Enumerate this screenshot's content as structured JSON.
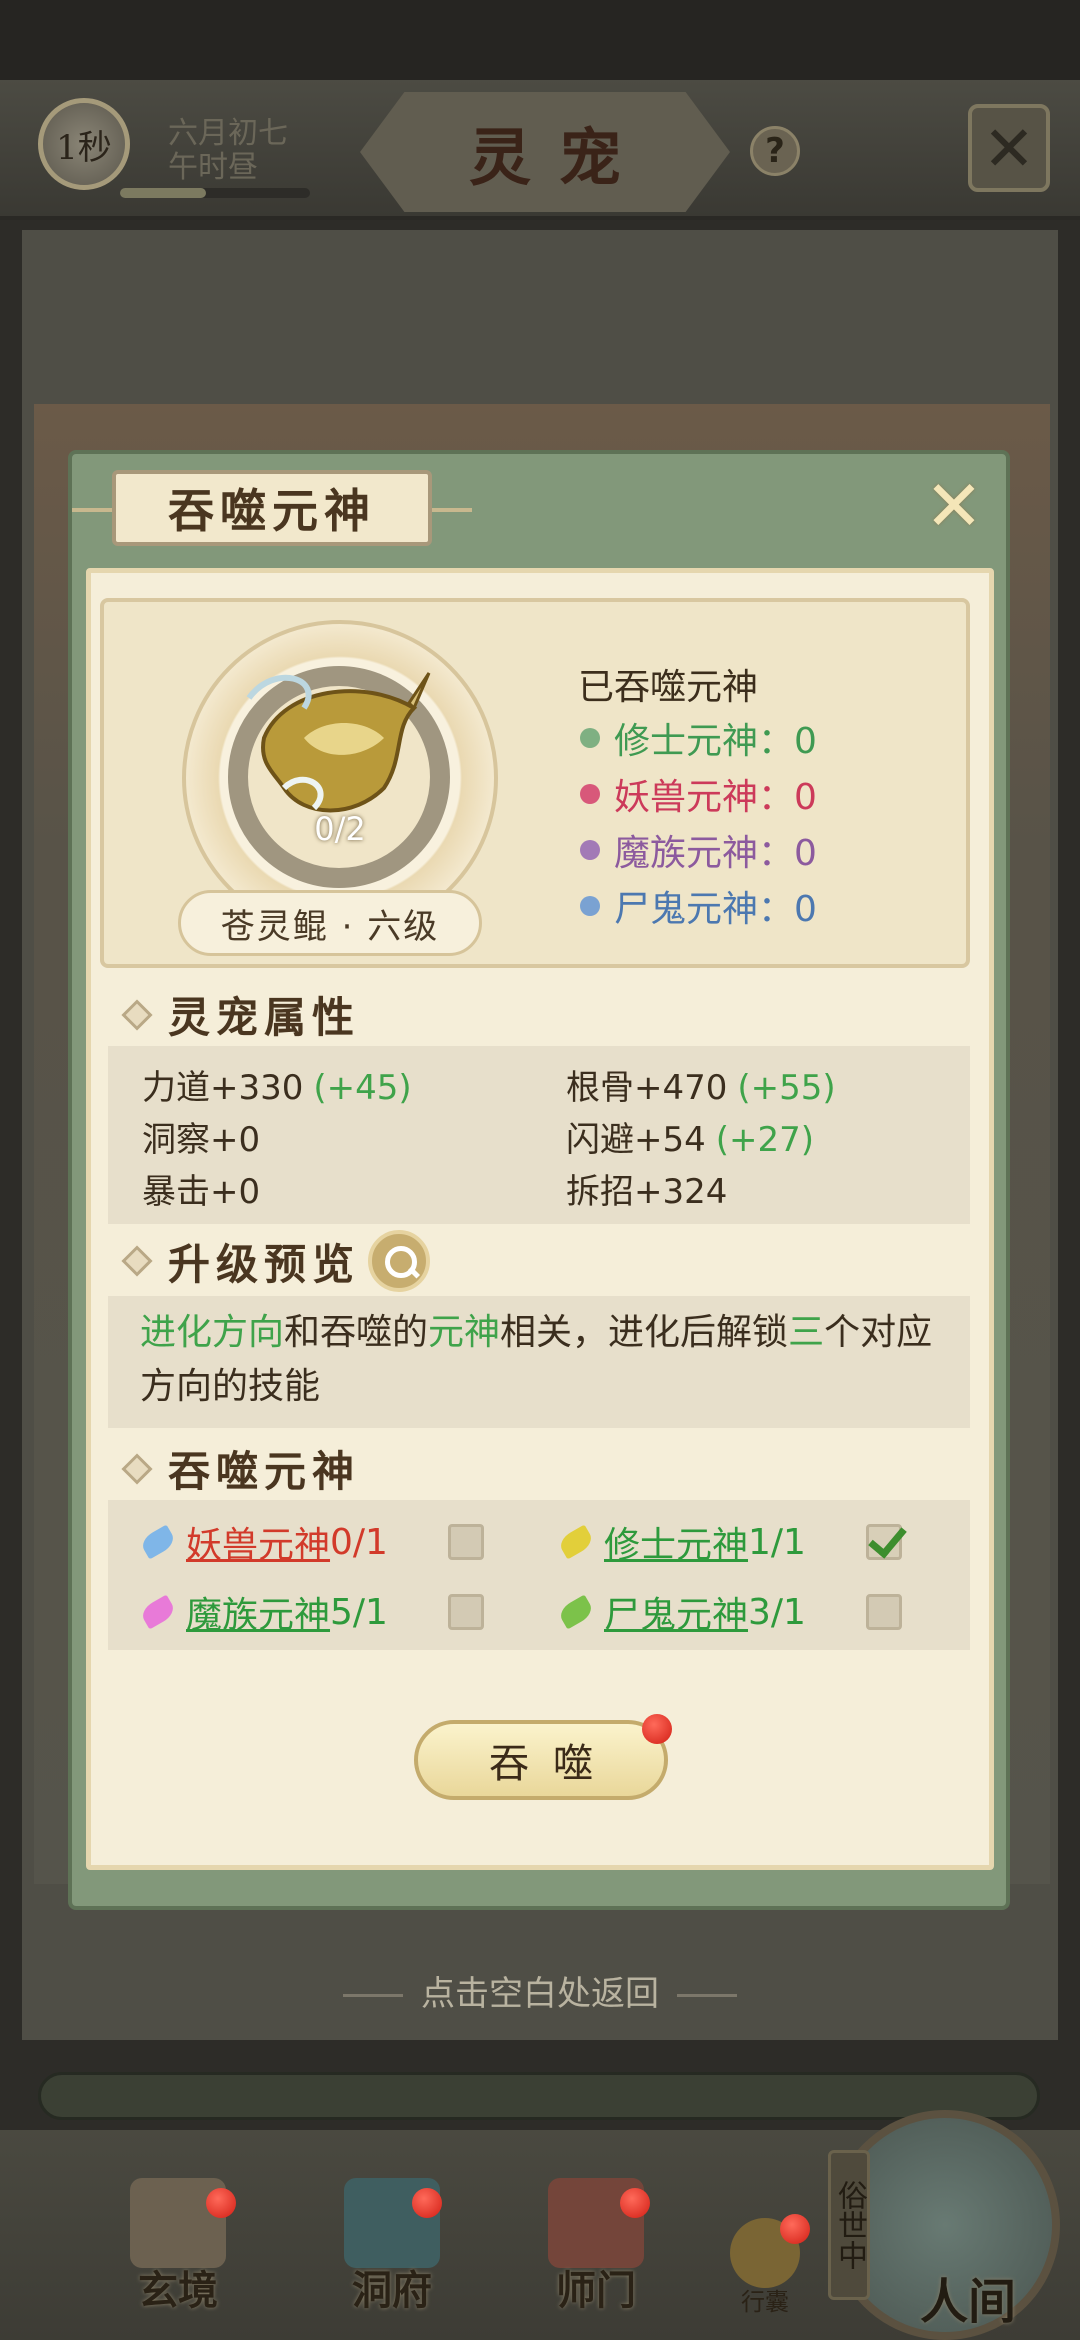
{
  "topbar": {
    "timer": "1秒",
    "date_line1": "六月初七",
    "date_line2": "午时昼",
    "title": "灵宠",
    "help_label": "?",
    "time_progress": 0.45
  },
  "dialog": {
    "title": "吞噬元神",
    "pet": {
      "count": "0/2",
      "name": "苍灵鲲 · 六级"
    },
    "devoured": {
      "title": "已吞噬元神",
      "items": [
        {
          "label": "修士元神：0",
          "color": "#3f9a52",
          "dot": "#7fb082"
        },
        {
          "label": "妖兽元神：0",
          "color": "#cc3a5a",
          "dot": "#d8587a"
        },
        {
          "label": "魔族元神：0",
          "color": "#8c5a9e",
          "dot": "#a27ab6"
        },
        {
          "label": "尸鬼元神：0",
          "color": "#4c78b0",
          "dot": "#7aa2d2"
        }
      ]
    },
    "attributes": {
      "heading": "灵宠属性",
      "items": [
        {
          "label": "力道+330",
          "bonus": "(+45)"
        },
        {
          "label": "根骨+470",
          "bonus": "(+55)"
        },
        {
          "label": "洞察+0",
          "bonus": ""
        },
        {
          "label": "闪避+54",
          "bonus": "(+27)"
        },
        {
          "label": "暴击+0",
          "bonus": ""
        },
        {
          "label": "拆招+324",
          "bonus": ""
        }
      ]
    },
    "preview": {
      "heading": "升级预览",
      "seg1": "进化方向",
      "seg2": "和吞噬的",
      "seg3": "元神",
      "seg4": "相关，进化后解锁",
      "seg5": "三",
      "seg6": "个对应方向的技能"
    },
    "devour_section": {
      "heading": "吞噬元神",
      "items": [
        {
          "name": "妖兽元神",
          "count": "0/1",
          "name_color": "#d23a2a",
          "count_color": "#d23a2a",
          "leaf": "#7fb6e8",
          "checked": false
        },
        {
          "name": "修士元神",
          "count": "1/1",
          "name_color": "#2e9a3c",
          "count_color": "#2e9a3c",
          "leaf": "#e2cf3a",
          "checked": true
        },
        {
          "name": "魔族元神",
          "count": "5/1",
          "name_color": "#2e9a3c",
          "count_color": "#2e9a3c",
          "leaf": "#e87ad8",
          "checked": false
        },
        {
          "name": "尸鬼元神",
          "count": "3/1",
          "name_color": "#2e9a3c",
          "count_color": "#2e9a3c",
          "leaf": "#7cc24a",
          "checked": false
        }
      ]
    },
    "devour_button": "吞噬"
  },
  "return_hint": "点击空白处返回",
  "bottom_nav": [
    {
      "label": "玄境",
      "icon": "scroll-icon"
    },
    {
      "label": "洞府",
      "icon": "pavilion-icon"
    },
    {
      "label": "师门",
      "icon": "banner-icon"
    },
    {
      "label": "行囊",
      "icon": "bag-icon"
    }
  ],
  "world": {
    "vertical": "俗世中",
    "label": "人间"
  }
}
